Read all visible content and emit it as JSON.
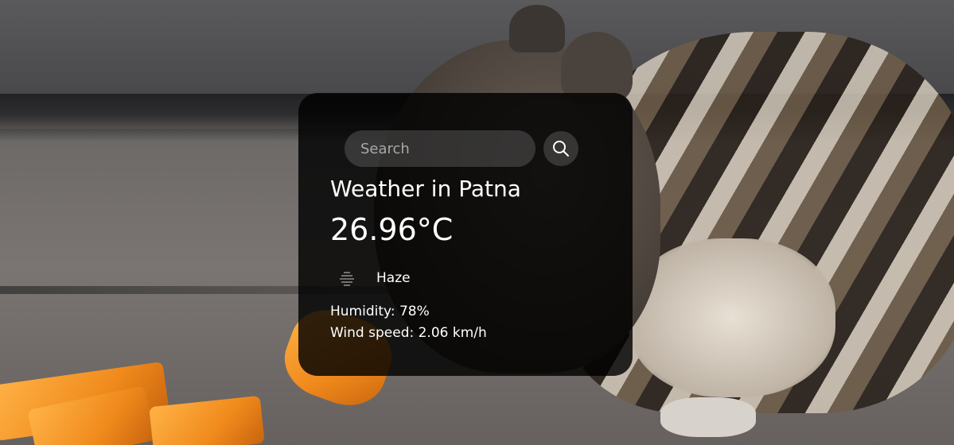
{
  "search": {
    "placeholder": "Search",
    "value": "",
    "button_icon": "search-icon"
  },
  "weather": {
    "title": "Weather in Patna",
    "temperature": "26.96°C",
    "condition_icon": "haze-icon",
    "description": "Haze",
    "humidity": "Humidity: 78%",
    "wind": "Wind speed: 2.06 km/h"
  },
  "colors": {
    "card_background": "#000000",
    "text": "#ffffff",
    "input_background": "#7c7c7c",
    "placeholder": "#a8a8a8"
  }
}
